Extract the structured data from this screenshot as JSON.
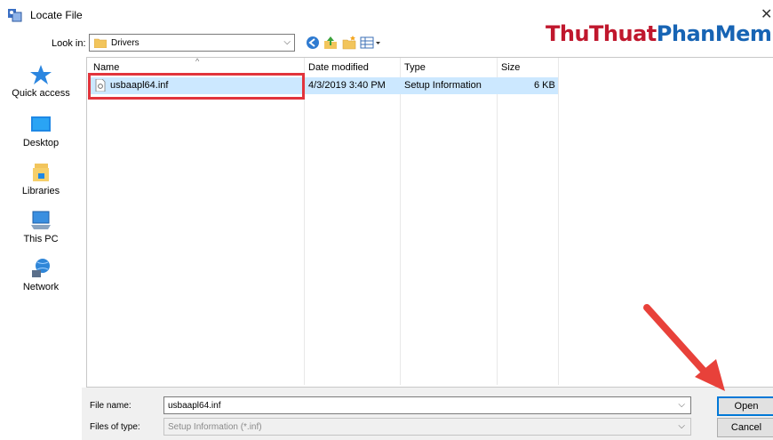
{
  "window": {
    "title": "Locate File",
    "close_glyph": "✕"
  },
  "watermark": {
    "part1": "ThuThuat",
    "part2": "PhanMem.vn"
  },
  "toolbar": {
    "look_in_label": "Look in:",
    "look_in_value": "Drivers",
    "icons": [
      "back-icon",
      "up-folder-icon",
      "new-folder-icon",
      "view-menu-icon"
    ]
  },
  "places": [
    {
      "label": "Quick access",
      "icon": "star-icon"
    },
    {
      "label": "Desktop",
      "icon": "desktop-icon"
    },
    {
      "label": "Libraries",
      "icon": "libraries-icon"
    },
    {
      "label": "This PC",
      "icon": "computer-icon"
    },
    {
      "label": "Network",
      "icon": "network-icon"
    }
  ],
  "columns": [
    "Name",
    "Date modified",
    "Type",
    "Size"
  ],
  "files": [
    {
      "name": "usbaapl64.inf",
      "date": "4/3/2019 3:40 PM",
      "type": "Setup Information",
      "size": "6 KB"
    }
  ],
  "footer": {
    "file_name_label": "File name:",
    "file_name_value": "usbaapl64.inf",
    "file_type_label": "Files of type:",
    "file_type_value": "Setup Information (*.inf)",
    "open_label": "Open",
    "cancel_label": "Cancel"
  },
  "colors": {
    "selection": "#cce8ff",
    "highlight_box": "#e2343c",
    "annotation_arrow": "#e8413a",
    "default_button_border": "#0078d7"
  }
}
